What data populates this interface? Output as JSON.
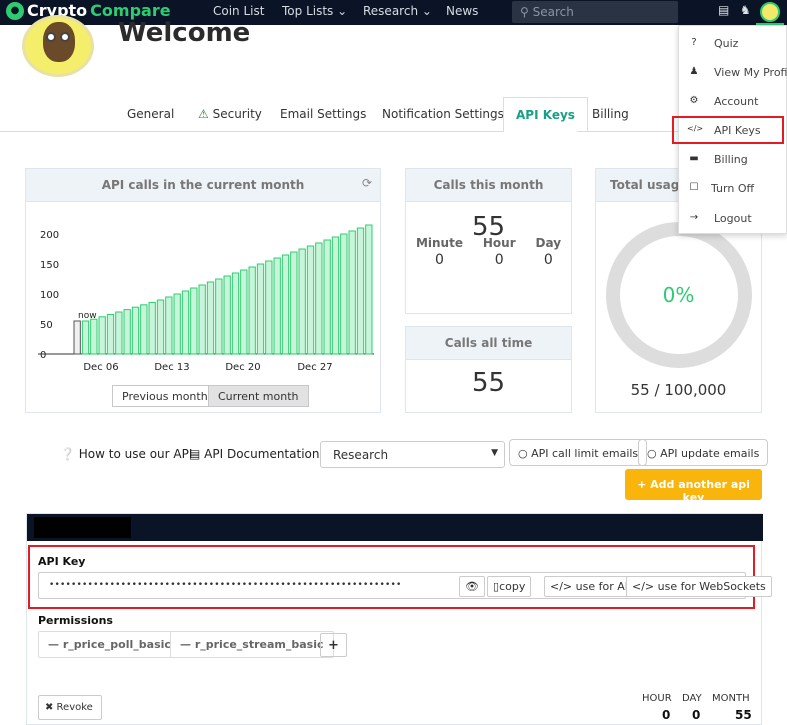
{
  "nav": {
    "brand_part1": "Crypto",
    "brand_part2": "Compare",
    "links": [
      "Coin List",
      "Top Lists ⌄",
      "Research ⌄",
      "News"
    ],
    "search_placeholder": "Search"
  },
  "header": {
    "title": "Welcome"
  },
  "tabs": [
    {
      "label": "General"
    },
    {
      "label": "Security"
    },
    {
      "label": "Email Settings"
    },
    {
      "label": "Notification Settings"
    },
    {
      "label": "API Keys"
    },
    {
      "label": "Billing"
    }
  ],
  "chart_panel": {
    "title": "API calls in the current month",
    "prev_button": "Previous months",
    "curr_button": "Current month"
  },
  "chart_data": {
    "type": "bar",
    "xticks": [
      "Dec 06",
      "Dec 13",
      "Dec 20",
      "Dec 27"
    ],
    "yticks": [
      0,
      50,
      100,
      150,
      200
    ],
    "ylim": [
      0,
      230
    ],
    "values": [
      55,
      55,
      58,
      62,
      66,
      70,
      74,
      78,
      82,
      86,
      90,
      95,
      100,
      105,
      110,
      115,
      120,
      125,
      130,
      135,
      140,
      145,
      150,
      155,
      160,
      165,
      170,
      175,
      180,
      185,
      190,
      195,
      200,
      205,
      210,
      215
    ],
    "annotation": "now",
    "bar_color": "#c8f5da",
    "bar_edge": "#2ecc71"
  },
  "calls_month": {
    "title": "Calls this month",
    "value": "55",
    "minute_label": "Minute",
    "minute_value": "0",
    "hour_label": "Hour",
    "hour_value": "0",
    "day_label": "Day",
    "day_value": "0"
  },
  "calls_all": {
    "title": "Calls all time",
    "value": "55"
  },
  "total_usage": {
    "title": "Total usage t",
    "percent": "0%",
    "fraction": "55 / 100,000",
    "ring_color": "#dddddd",
    "accent": "#2ecc71"
  },
  "menu": {
    "items": [
      {
        "icon": "?",
        "label": "Quiz"
      },
      {
        "icon": "♟",
        "label": "View My Profile"
      },
      {
        "icon": "⚙",
        "label": "Account"
      },
      {
        "icon": "</>",
        "label": "API Keys"
      },
      {
        "icon": "▬",
        "label": "Billing"
      },
      {
        "icon": "☐",
        "label": "Turn Off"
      },
      {
        "icon": "→",
        "label": "Logout"
      }
    ]
  },
  "links_row": {
    "how_to": "How to use our API",
    "docs": "API Documentation",
    "select_value": "Research",
    "limit_emails": "API call limit emails",
    "update_emails": "API update emails",
    "add_key": "+ Add another api key"
  },
  "api_key_panel": {
    "key_label": "API Key",
    "key_value": "••••••••••••••••••••••••••••••••••••••••••••••••••••••••••••••••",
    "copy_label": "copy",
    "use_api_label": "</> use for API",
    "use_ws_label": "</> use for WebSockets",
    "permissions_label": "Permissions",
    "permissions": [
      "— r_price_poll_basic",
      "— r_price_stream_basic"
    ],
    "revoke_label": "✖ Revoke",
    "usage": {
      "hour_label": "HOUR",
      "day_label": "DAY",
      "month_label": "MONTH",
      "hour_value": "0",
      "day_value": "0",
      "month_value": "55"
    }
  },
  "colors": {
    "nav_bg": "#0b1426",
    "brand_green": "#2ecc71",
    "accent_teal": "#16a085",
    "warning_orange": "#f9b50b",
    "highlight_red": "#e31b23"
  }
}
